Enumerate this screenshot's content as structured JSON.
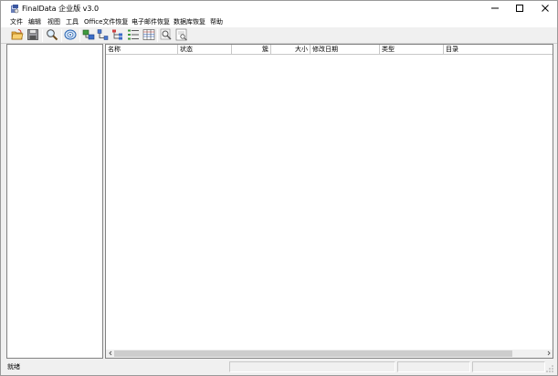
{
  "window": {
    "title": "FinalData 企业版 v3.0",
    "icons": {
      "app": "finaldata-app-icon",
      "minimize": "minimize-icon",
      "maximize": "maximize-icon",
      "close": "close-icon"
    }
  },
  "menu": {
    "items": [
      {
        "id": "file",
        "label": "文件"
      },
      {
        "id": "edit",
        "label": "编辑"
      },
      {
        "id": "view",
        "label": "视图"
      },
      {
        "id": "tools",
        "label": "工具"
      },
      {
        "id": "office",
        "label": "Office文件恢复"
      },
      {
        "id": "email",
        "label": "电子邮件恢复"
      },
      {
        "id": "database",
        "label": "数据库恢复"
      },
      {
        "id": "help",
        "label": "帮助"
      }
    ]
  },
  "toolbar": {
    "buttons": [
      {
        "id": "open",
        "icon": "open-folder-icon"
      },
      {
        "id": "save",
        "icon": "save-disk-icon"
      },
      {
        "id": "find",
        "icon": "magnifier-icon"
      },
      {
        "id": "scan",
        "icon": "scan-drive-icon"
      },
      {
        "id": "move-up",
        "icon": "move-tree-icon"
      },
      {
        "id": "connect",
        "icon": "connect-nodes-icon"
      },
      {
        "id": "tree-view",
        "icon": "tree-view-icon"
      },
      {
        "id": "list-view",
        "icon": "list-view-icon"
      },
      {
        "id": "zoom",
        "icon": "zoom-icon"
      },
      {
        "id": "preview",
        "icon": "preview-icon"
      }
    ]
  },
  "list": {
    "columns": [
      {
        "id": "name",
        "label": "名称"
      },
      {
        "id": "status",
        "label": "状态"
      },
      {
        "id": "cluster",
        "label": "簇"
      },
      {
        "id": "size",
        "label": "大小"
      },
      {
        "id": "modified",
        "label": "修改日期"
      },
      {
        "id": "type",
        "label": "类型"
      },
      {
        "id": "directory",
        "label": "目录"
      }
    ],
    "rows": []
  },
  "status": {
    "text": "就绪"
  }
}
